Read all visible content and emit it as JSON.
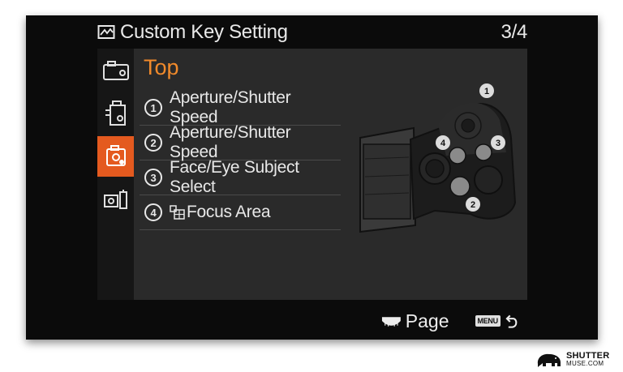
{
  "header": {
    "title": "Custom Key Setting",
    "page_indicator": "3/4",
    "title_icon": "custom-key-icon"
  },
  "tabs": [
    {
      "name": "camera1-tab",
      "icon": "camera-icon",
      "active": false
    },
    {
      "name": "camera2-tab",
      "icon": "camera2-icon",
      "active": false
    },
    {
      "name": "custom-tab",
      "icon": "custom-key-icon",
      "active": true
    },
    {
      "name": "playback-tab",
      "icon": "playback-icon",
      "active": false
    }
  ],
  "section": {
    "title": "Top"
  },
  "items": [
    {
      "num": "1",
      "label": "Aperture/Shutter Speed"
    },
    {
      "num": "2",
      "label": "Aperture/Shutter Speed"
    },
    {
      "num": "3",
      "label": "Face/Eye Subject Select"
    },
    {
      "num": "4",
      "label": "Focus Area",
      "icon": "focus-area-icon"
    }
  ],
  "diagram": {
    "callouts": [
      "1",
      "2",
      "3",
      "4"
    ]
  },
  "footer": {
    "page_label": "Page",
    "menu_button": "MENU"
  },
  "watermark": {
    "line1": "SHUTTER",
    "line2": "MUSE.COM"
  },
  "colors": {
    "accent": "#e45a1f",
    "section_title": "#f18a2b",
    "panel": "#2a2a2a",
    "screen": "#0b0b0b"
  }
}
